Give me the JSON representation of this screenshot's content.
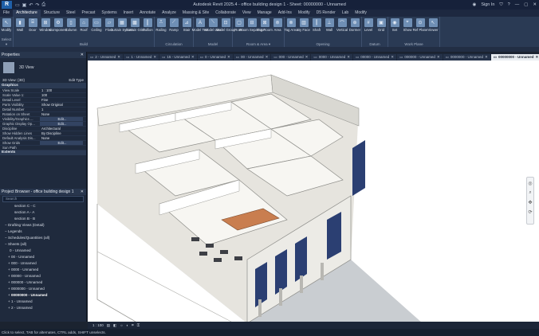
{
  "window": {
    "title": "Autodesk Revit 2025.4 - office building design 1 - Sheet: 00000000 - Unnamed",
    "sign_in": "Sign In"
  },
  "menu_tabs": [
    "File",
    "Architecture",
    "Structure",
    "Steel",
    "Precast",
    "Systems",
    "Insert",
    "Annotate",
    "Analyze",
    "Massing & Site",
    "Collaborate",
    "View",
    "Manage",
    "Add-Ins",
    "Modify",
    "D5 Render",
    "Lab",
    "Modify"
  ],
  "ribbon": {
    "groups": [
      {
        "label": "Select ▾",
        "tools": [
          "Modify"
        ]
      },
      {
        "label": "Build",
        "tools": [
          "Wall",
          "Door",
          "Window",
          "Component",
          "Column",
          "Roof",
          "Ceiling",
          "Floor",
          "Curtain System",
          "Curtain Grid",
          "Mullion"
        ]
      },
      {
        "label": "Circulation",
        "tools": [
          "Railing",
          "Ramp",
          "Stair"
        ]
      },
      {
        "label": "Model",
        "tools": [
          "Model Text",
          "Model Line",
          "Model Group"
        ]
      },
      {
        "label": "Room & Area ▾",
        "tools": [
          "Room",
          "Room Separator",
          "Tag Room",
          "Area"
        ]
      },
      {
        "label": "Opening",
        "tools": [
          "Tag Area",
          "By Face",
          "Shaft",
          "Wall",
          "Vertical",
          "Dormer"
        ]
      },
      {
        "label": "Datum",
        "tools": [
          "Level",
          "Grid"
        ]
      },
      {
        "label": "Work Plane",
        "tools": [
          "Set",
          "Show",
          "Ref Plane",
          "Viewer"
        ]
      }
    ]
  },
  "properties": {
    "title": "Properties",
    "type_name": "3D View",
    "selector_value": "3D View: {3D}",
    "edit_type": "Edit Type",
    "sections": [
      {
        "name": "Graphics",
        "rows": [
          [
            "View Scale",
            "1 : 100"
          ],
          [
            "Scale Value 1:",
            "100"
          ],
          [
            "Detail Level",
            "Fine"
          ],
          [
            "Parts Visibility",
            "Show Original"
          ],
          [
            "Detail Number",
            "1"
          ],
          [
            "Rotation on Sheet",
            "None"
          ],
          [
            "Visibility/Graphics ...",
            "Edit..."
          ],
          [
            "Graphic Display Op...",
            "Edit..."
          ],
          [
            "Discipline",
            "Architectural"
          ],
          [
            "Show Hidden Lines",
            "By Discipline"
          ],
          [
            "Default Analysis Dis...",
            "None"
          ],
          [
            "Show Grids",
            "Edit..."
          ],
          [
            "Sun Path",
            ""
          ]
        ]
      },
      {
        "name": "Extents",
        "rows": []
      }
    ],
    "help": "Properties help",
    "apply": "Apply"
  },
  "project_browser": {
    "title": "Project Browser - office building design 1",
    "search_placeholder": "Search",
    "items": [
      "section C - C",
      "section A - A",
      "section B - B",
      "Drafting Views (Detail)",
      "Legends",
      "Schedules/Quantities (all)",
      "Sheets (all)",
      "0 - Unnamed",
      "00 - Unnamed",
      "000 - Unnamed",
      "0000 - Unnamed",
      "00000 - Unnamed",
      "000000 - Unnamed",
      "0000000 - Unnamed",
      "00000000 - Unnamed",
      "1 - Unnamed",
      "2 - Unnamed"
    ]
  },
  "view_tabs": [
    "2 - Unnamed",
    "1 - Unnamed",
    "15 - Unnamed",
    "0 - Unnamed",
    "00 - Unnamed",
    "000 - Unnamed",
    "0000 - Unnamed",
    "00000 - Unnamed",
    "000000 - Unnamed",
    "0000000 - Unnamed",
    "00000000 - Unnamed"
  ],
  "view_control": {
    "scale": "1 : 100"
  },
  "status": "Click to select, TAB for alternates, CTRL adds, SHIFT unselects."
}
